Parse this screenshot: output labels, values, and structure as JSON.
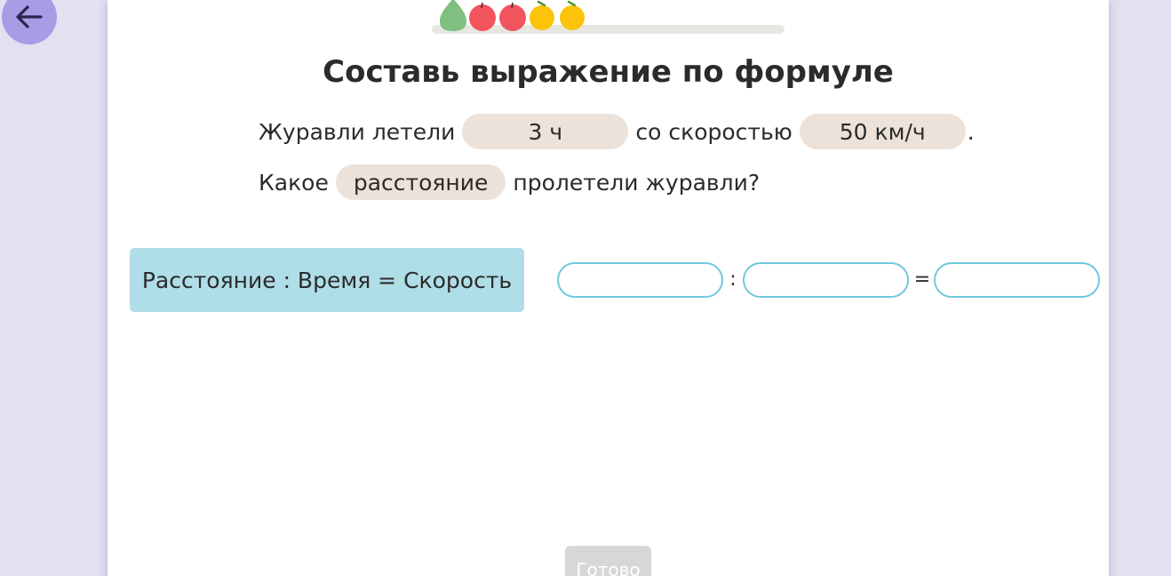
{
  "navigation": {
    "back_icon": "arrow-left-icon"
  },
  "progress": {
    "fruit_icons": [
      "pear-icon",
      "apple-icon",
      "apple-icon",
      "orange-icon",
      "orange-icon"
    ]
  },
  "task": {
    "title": "Составь выражение по формуле",
    "line1": {
      "part1": "Журавли летели",
      "chip_time": "3 ч",
      "part2": "со скоростью",
      "chip_speed": "50 км/ч",
      "part3": "."
    },
    "line2": {
      "part1": "Какое",
      "chip_distance": "расстояние",
      "part2": "пролетели журавли?"
    }
  },
  "formula": {
    "card_text": "Расстояние : Время = Скорость",
    "operator_divide": ":",
    "operator_equals": "="
  },
  "actions": {
    "done_label": "Готово"
  },
  "colors": {
    "background": "#e3e0f2",
    "back_button": "#a99be6",
    "chip": "#ece2d9",
    "formula_card": "#afdde8",
    "slot_border": "#6ec9de",
    "done_button": "#d7d7d7",
    "pear": "#7fbf7f",
    "apple": "#f2545e",
    "orange": "#fcc30a"
  }
}
